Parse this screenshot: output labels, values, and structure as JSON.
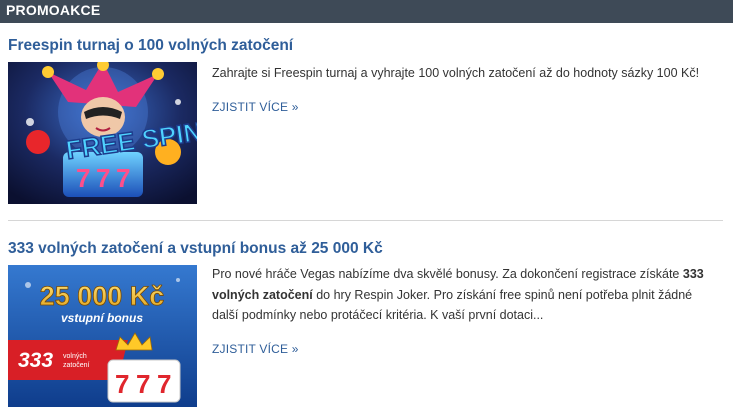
{
  "header": {
    "title": "PROMOAKCE"
  },
  "promos": [
    {
      "title": "Freespin turnaj o 100 volných zatočení",
      "image_text": "FREE SPIN",
      "description": "Zahrajte si Freespin turnaj a vyhrajte 100 volných zatočení až do hodnoty sázky 100 Kč!",
      "more_label": "ZJISTIT VÍCE »"
    },
    {
      "title": "333 volných zatočení a vstupní bonus až 25 000 Kč",
      "image_amount": "25 000 Kč",
      "image_bonus": "vstupní bonus",
      "image_spins_number": "333",
      "image_spins_l1": "volných",
      "image_spins_l2": "zatočení",
      "desc_part1": "Pro nové hráče Vegas nabízíme dva skvělé bonusy. Za dokončení registrace získáte ",
      "desc_bold": "333 volných zatočení",
      "desc_part2": " do hry Respin Joker. Pro získání free spinů není potřeba plnit žádné další podmínky nebo protáčecí kritéria. K vaší první dotaci...",
      "more_label": "ZJISTIT VÍCE »"
    }
  ],
  "colors": {
    "header_bg": "#3e4a57",
    "link": "#2f5e99",
    "banner_red": "#d81f26",
    "banner_blue": "#1d5fb5"
  }
}
